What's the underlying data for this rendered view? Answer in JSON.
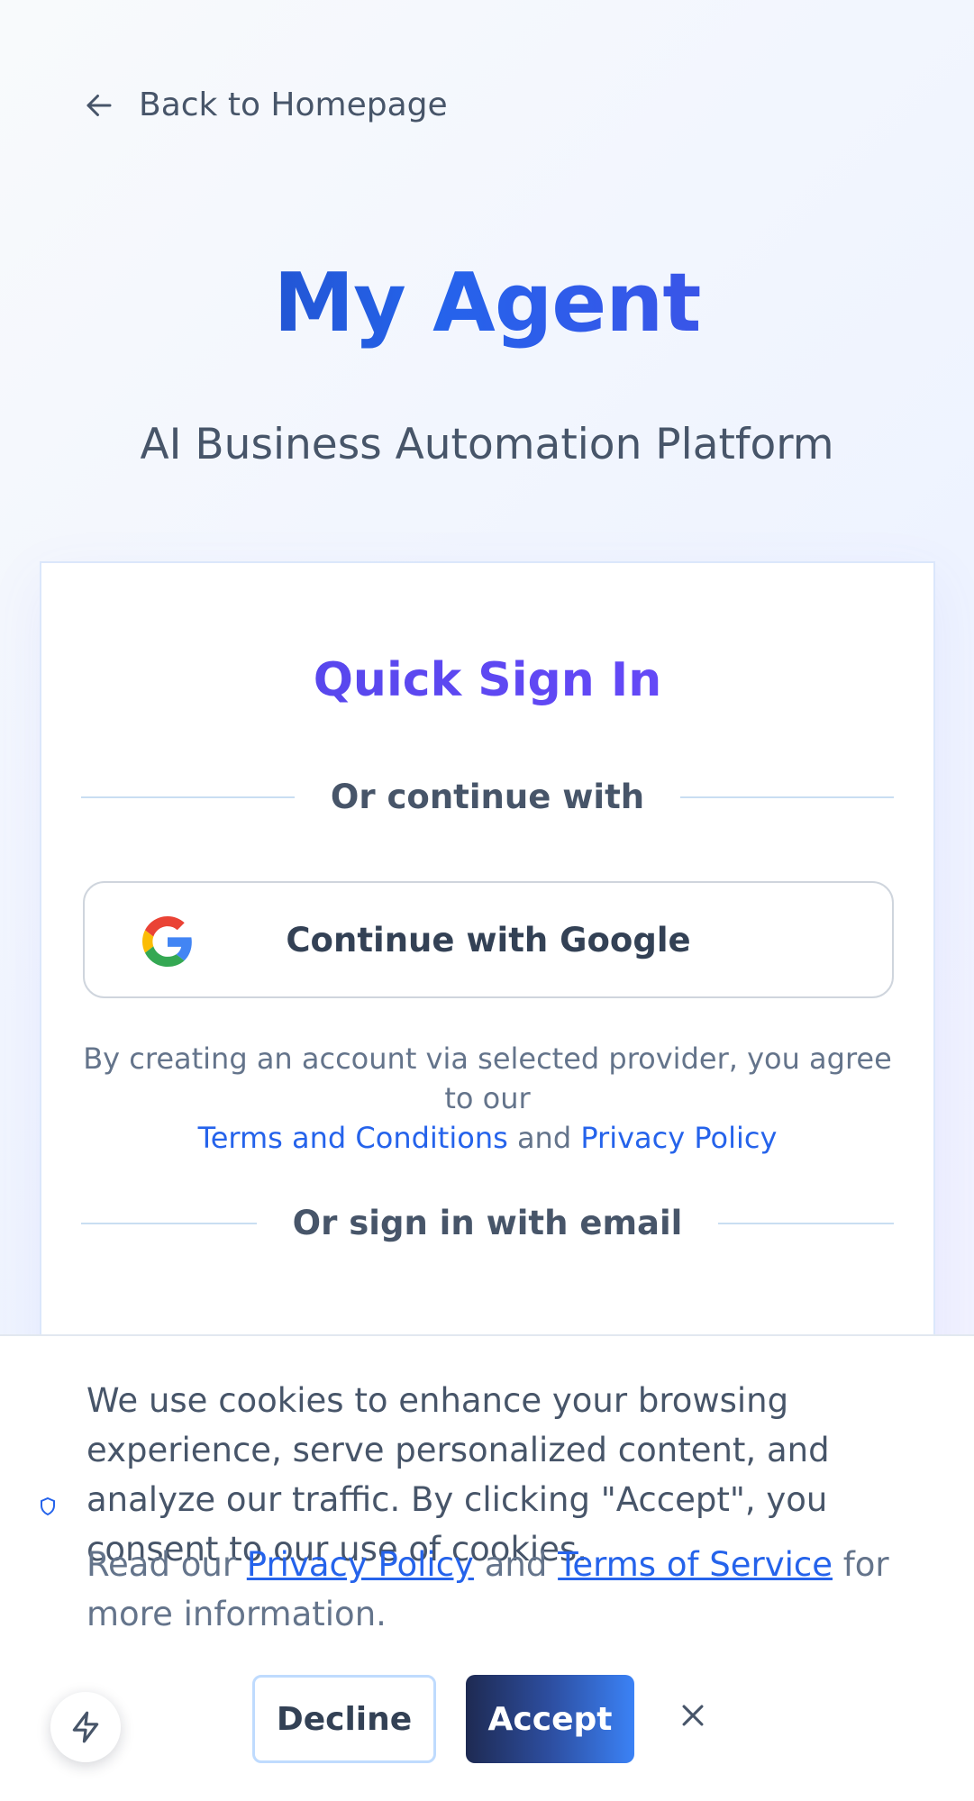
{
  "nav": {
    "back_label": "Back to Homepage"
  },
  "hero": {
    "brand": "My Agent",
    "tagline": "AI Business Automation Platform"
  },
  "card": {
    "title": "Quick Sign In",
    "divider_social": "Or continue with",
    "google_label": "Continue with Google",
    "terms": {
      "prefix": "By creating an account via selected provider, you agree to our",
      "terms_link": "Terms and Conditions",
      "and": "and",
      "privacy_link": "Privacy Policy"
    },
    "divider_email": "Or sign in with email"
  },
  "cookie": {
    "message": "We use cookies to enhance your browsing experience, serve personalized content, and analyze our traffic. By clicking \"Accept\", you consent to our use of cookies.",
    "read_prefix": "Read our",
    "privacy_link": "Privacy Policy",
    "and": "and",
    "terms_link": "Terms of Service",
    "read_suffix": "for more information.",
    "decline_label": "Decline",
    "accept_label": "Accept"
  },
  "colors": {
    "brand_blue": "#2563eb",
    "brand_indigo": "#4f46e5",
    "link": "#2563eb",
    "accept_dark": "#1e2a52"
  },
  "icons": {
    "back": "arrow-left-icon",
    "google": "google-logo-icon",
    "cookie_badge": "shield-icon",
    "close": "close-icon",
    "fab": "lightning-icon"
  }
}
